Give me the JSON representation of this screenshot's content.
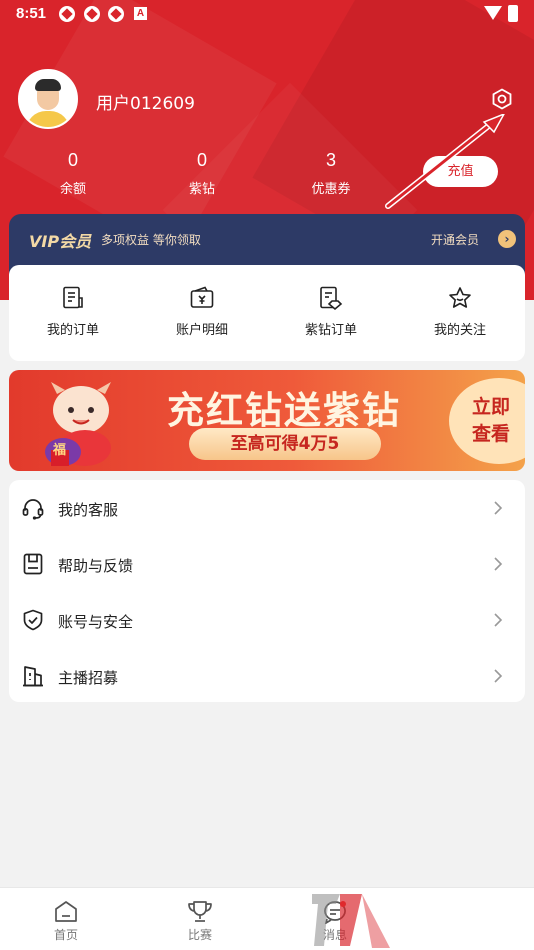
{
  "status_bar": {
    "time": "8:51",
    "badge_letter": "A"
  },
  "profile": {
    "username": "用户012609"
  },
  "stats": [
    {
      "value": "0",
      "label": "余额"
    },
    {
      "value": "0",
      "label": "紫钻"
    },
    {
      "value": "3",
      "label": "优惠券"
    }
  ],
  "recharge_label": "充值",
  "vip": {
    "logo": "VIP会员",
    "desc": "多项权益 等你领取",
    "open_label": "开通会员"
  },
  "quick_actions": [
    {
      "label": "我的订单",
      "icon": "order-icon"
    },
    {
      "label": "账户明细",
      "icon": "wallet-icon"
    },
    {
      "label": "紫钻订单",
      "icon": "diamond-order-icon"
    },
    {
      "label": "我的关注",
      "icon": "star-icon"
    }
  ],
  "banner": {
    "title": "充红钻送紫钻",
    "subtitle": "至高可得4万5",
    "cta_line1": "立即",
    "cta_line2": "查看",
    "mascot_text": "福"
  },
  "menu": [
    {
      "label": "我的客服",
      "icon": "headset-icon"
    },
    {
      "label": "帮助与反馈",
      "icon": "feedback-icon"
    },
    {
      "label": "账号与安全",
      "icon": "shield-icon"
    },
    {
      "label": "主播招募",
      "icon": "building-icon"
    }
  ],
  "tabs": [
    {
      "label": "首页",
      "icon": "home-icon"
    },
    {
      "label": "比赛",
      "icon": "trophy-icon"
    },
    {
      "label": "消息",
      "icon": "message-icon"
    }
  ],
  "colors": {
    "primary_red": "#d9242b",
    "vip_navy": "#2d3a66",
    "vip_gold": "#f1c27a"
  }
}
